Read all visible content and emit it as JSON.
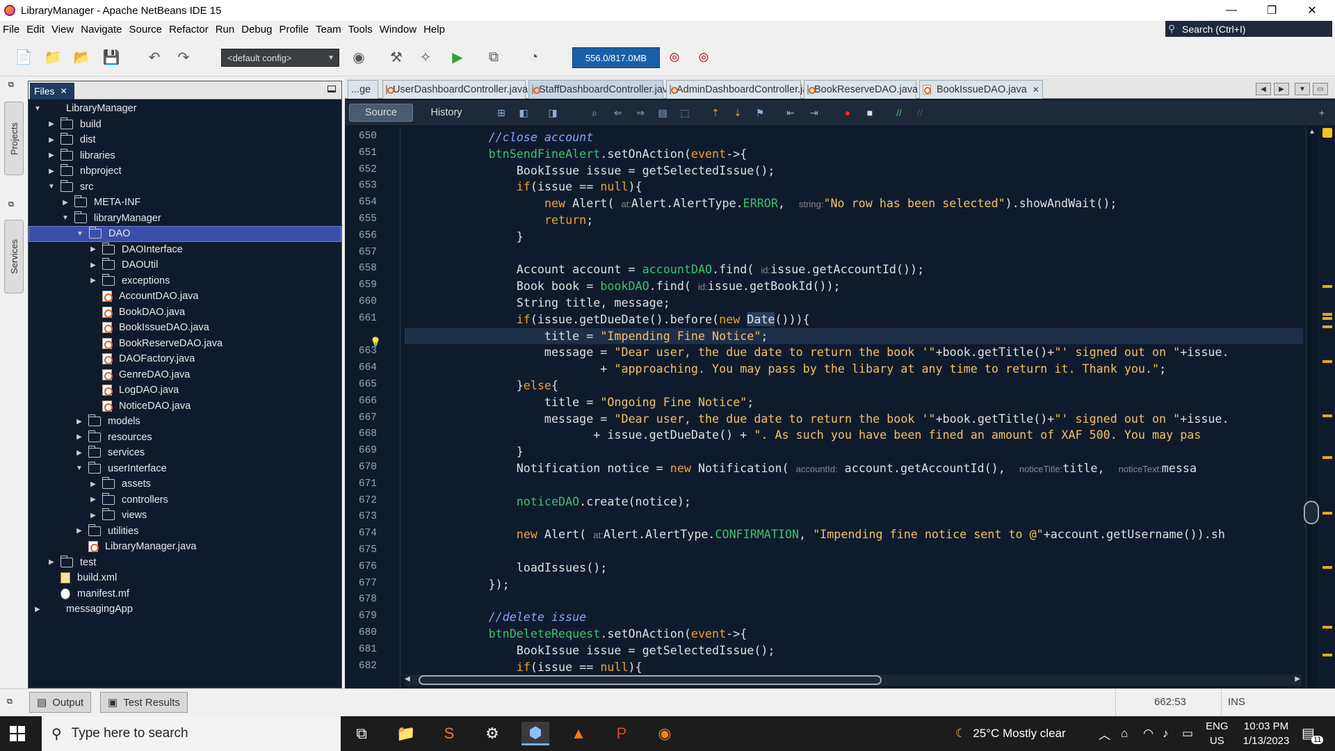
{
  "window": {
    "title": "LibraryManager - Apache NetBeans IDE 15"
  },
  "menu": [
    "File",
    "Edit",
    "View",
    "Navigate",
    "Source",
    "Refactor",
    "Run",
    "Debug",
    "Profile",
    "Team",
    "Tools",
    "Window",
    "Help"
  ],
  "search": {
    "placeholder": "Search (Ctrl+I)"
  },
  "toolbar": {
    "config": "<default config>",
    "memory": "556.0/817.0MB"
  },
  "side_tabs": {
    "projects": "Projects",
    "services": "Services"
  },
  "files_panel": {
    "tab": "Files",
    "tree": [
      {
        "label": "LibraryManager",
        "depth": 0,
        "type": "project",
        "open": true
      },
      {
        "label": "build",
        "depth": 1,
        "type": "folder",
        "open": false
      },
      {
        "label": "dist",
        "depth": 1,
        "type": "folder",
        "open": false
      },
      {
        "label": "libraries",
        "depth": 1,
        "type": "folder",
        "open": false
      },
      {
        "label": "nbproject",
        "depth": 1,
        "type": "folder",
        "open": false
      },
      {
        "label": "src",
        "depth": 1,
        "type": "folder",
        "open": true
      },
      {
        "label": "META-INF",
        "depth": 2,
        "type": "folder",
        "open": false
      },
      {
        "label": "libraryManager",
        "depth": 2,
        "type": "folder",
        "open": true
      },
      {
        "label": "DAO",
        "depth": 3,
        "type": "folder",
        "open": true,
        "selected": true
      },
      {
        "label": "DAOInterface",
        "depth": 4,
        "type": "folder",
        "open": false
      },
      {
        "label": "DAOUtil",
        "depth": 4,
        "type": "folder",
        "open": false
      },
      {
        "label": "exceptions",
        "depth": 4,
        "type": "folder",
        "open": false
      },
      {
        "label": "AccountDAO.java",
        "depth": 4,
        "type": "java"
      },
      {
        "label": "BookDAO.java",
        "depth": 4,
        "type": "java"
      },
      {
        "label": "BookIssueDAO.java",
        "depth": 4,
        "type": "java"
      },
      {
        "label": "BookReserveDAO.java",
        "depth": 4,
        "type": "java"
      },
      {
        "label": "DAOFactory.java",
        "depth": 4,
        "type": "java"
      },
      {
        "label": "GenreDAO.java",
        "depth": 4,
        "type": "java"
      },
      {
        "label": "LogDAO.java",
        "depth": 4,
        "type": "java"
      },
      {
        "label": "NoticeDAO.java",
        "depth": 4,
        "type": "java"
      },
      {
        "label": "models",
        "depth": 3,
        "type": "folder",
        "open": false
      },
      {
        "label": "resources",
        "depth": 3,
        "type": "folder",
        "open": false
      },
      {
        "label": "services",
        "depth": 3,
        "type": "folder",
        "open": false
      },
      {
        "label": "userInterface",
        "depth": 3,
        "type": "folder",
        "open": true
      },
      {
        "label": "assets",
        "depth": 4,
        "type": "folder",
        "open": false
      },
      {
        "label": "controllers",
        "depth": 4,
        "type": "folder",
        "open": false
      },
      {
        "label": "views",
        "depth": 4,
        "type": "folder",
        "open": false
      },
      {
        "label": "utilities",
        "depth": 3,
        "type": "folder",
        "open": false
      },
      {
        "label": "LibraryManager.java",
        "depth": 3,
        "type": "java"
      },
      {
        "label": "test",
        "depth": 1,
        "type": "folder",
        "open": false
      },
      {
        "label": "build.xml",
        "depth": 1,
        "type": "xml"
      },
      {
        "label": "manifest.mf",
        "depth": 1,
        "type": "mf"
      },
      {
        "label": "messagingApp",
        "depth": 0,
        "type": "project",
        "open": false
      }
    ]
  },
  "editor": {
    "tabs": [
      {
        "label": "...ge",
        "partial": true
      },
      {
        "label": "UserDashboardController.java"
      },
      {
        "label": "StaffDashboardController.java",
        "active": true
      },
      {
        "label": "AdminDashboardController.java"
      },
      {
        "label": "BookReserveDAO.java"
      },
      {
        "label": "BookIssueDAO.java"
      }
    ],
    "source_label": "Source",
    "history_label": "History",
    "line_numbers": [
      "650",
      "651",
      "652",
      "653",
      "654",
      "655",
      "656",
      "657",
      "658",
      "659",
      "660",
      "661",
      "",
      "663",
      "664",
      "665",
      "666",
      "667",
      "668",
      "669",
      "670",
      "671",
      "672",
      "673",
      "674",
      "675",
      "676",
      "677",
      "678",
      "679",
      "680",
      "681",
      "682"
    ],
    "lines": [
      "            <span class='cm'>//close account</span>",
      "            <span class='fl'>btnSendFineAlert</span>.setOnAction(<span class='kw'>event</span>-&gt;{",
      "                BookIssue issue = getSelectedIssue();",
      "                <span class='kw'>if</span>(issue == <span class='kw'>null</span>){",
      "                    <span class='kw'>new</span> Alert( <span class='hint'>at:</span>Alert.AlertType.<span class='fl'>ERROR</span>,  <span class='hint'>string:</span><span class='st'>\"No row has been selected\"</span>).showAndWait();",
      "                    <span class='kw'>return</span>;",
      "                }",
      "",
      "                Account account = <span class='fl'>accountDAO</span>.find( <span class='hint'>id:</span>issue.getAccountId());",
      "                Book book = <span class='fl'>bookDAO</span>.find( <span class='hint'>id:</span>issue.getBookId());",
      "                String title, message;",
      "                <span class='kw'>if</span>(issue.getDueDate().before(<span class='kw'>new</span> <span class='sel'>Date</span>())){",
      "                    title = <span class='st'>\"Impending Fine Notice\"</span>;",
      "                    message = <span class='st'>\"Dear user, the due date to return the book '\"</span>+book.getTitle()+<span class='st'>\"' signed out on \"</span>+issue.",
      "                            + <span class='st'>\"approaching. You may pass by the libary at any time to return it. Thank you.\"</span>;",
      "                }<span class='kw'>else</span>{",
      "                    title = <span class='st'>\"Ongoing Fine Notice\"</span>;",
      "                    message = <span class='st'>\"Dear user, the due date to return the book '\"</span>+book.getTitle()+<span class='st'>\"' signed out on \"</span>+issue.",
      "                           + issue.getDueDate() + <span class='st'>\". As such you have been fined an amount of XAF 500. You may pas</span>",
      "                }",
      "                Notification notice = <span class='kw'>new</span> Notification( <span class='hint'>accountId:</span> account.getAccountId(),  <span class='hint'>noticeTitle:</span>title,  <span class='hint'>noticeText:</span>messa",
      "",
      "                <span class='fl'>noticeDAO</span>.create(notice);",
      "",
      "                <span class='kw'>new</span> Alert( <span class='hint'>at:</span>Alert.AlertType.<span class='fl'>CONFIRMATION</span>, <span class='st'>\"Impending fine notice sent to @\"</span>+account.getUsername()).sh",
      "",
      "                loadIssues();",
      "            });",
      "",
      "            <span class='cm'>//delete issue</span>",
      "            <span class='fl'>btnDeleteRequest</span>.setOnAction(<span class='kw'>event</span>-&gt;{",
      "                BookIssue issue = getSelectedIssue();",
      "                <span class='kw'>if</span>(issue == <span class='kw'>null</span>){"
    ]
  },
  "status": {
    "output": "Output",
    "test_results": "Test Results",
    "caret": "662:53",
    "mode": "INS"
  },
  "taskbar": {
    "search_placeholder": "Type here to search",
    "weather": "25°C  Mostly clear",
    "lang": "ENG",
    "region": "US",
    "time": "10:03 PM",
    "date": "1/13/2023",
    "notif_count": "11"
  },
  "colors": {
    "editor_bg": "#0f1b2d",
    "keyword": "#f0a030",
    "string": "#f5c060",
    "field": "#3cc36a",
    "comment": "#8aa4ff"
  }
}
